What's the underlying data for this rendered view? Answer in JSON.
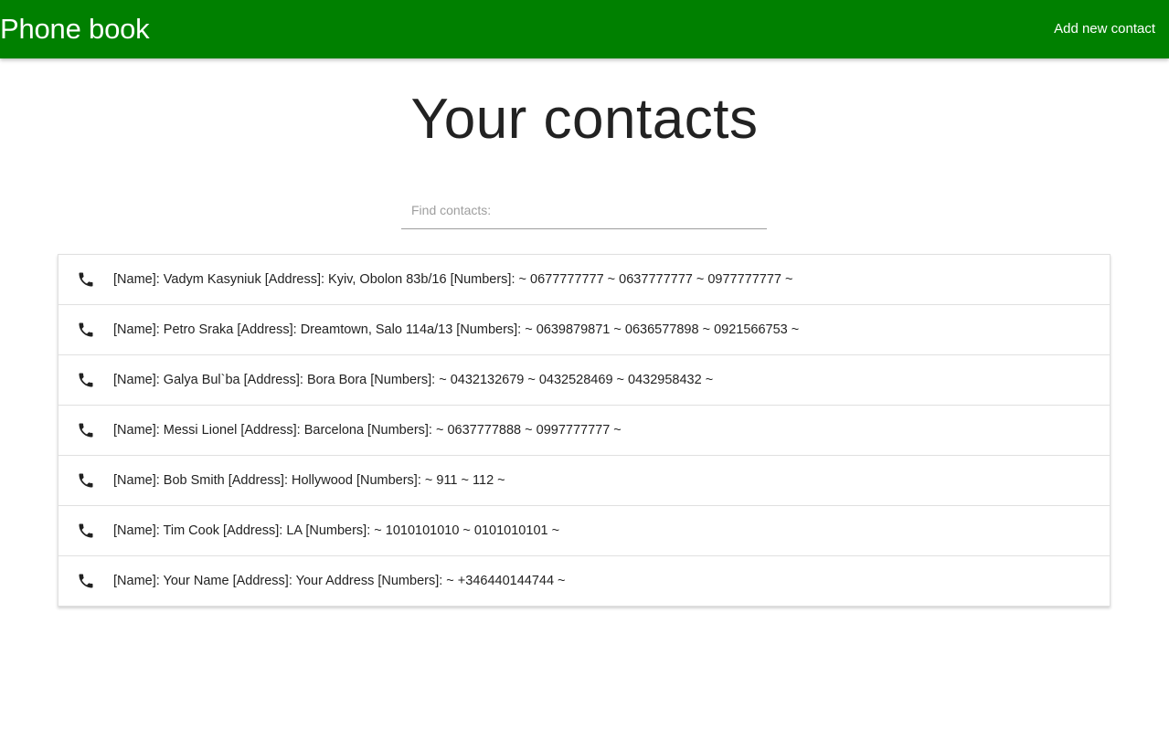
{
  "navbar": {
    "brand": "Phone book",
    "add_contact_label": "Add new contact",
    "background_color": "#008000"
  },
  "main": {
    "title": "Your contacts",
    "search": {
      "placeholder": "Find contacts:",
      "value": ""
    },
    "contacts": [
      {
        "icon": "phone-icon",
        "text": "[Name]: Vadym Kasyniuk [Address]: Kyiv, Obolon 83b/16 [Numbers]: ~ 0677777777 ~ 0637777777 ~ 0977777777 ~"
      },
      {
        "icon": "phone-icon",
        "text": "[Name]: Petro Sraka [Address]: Dreamtown, Salo 114a/13 [Numbers]: ~ 0639879871 ~ 0636577898 ~ 0921566753 ~"
      },
      {
        "icon": "phone-icon",
        "text": "[Name]: Galya Bul`ba [Address]: Bora Bora [Numbers]: ~ 0432132679 ~ 0432528469 ~ 0432958432 ~"
      },
      {
        "icon": "phone-icon",
        "text": "[Name]: Messi Lionel [Address]: Barcelona [Numbers]: ~ 0637777888 ~ 0997777777 ~"
      },
      {
        "icon": "phone-icon",
        "text": "[Name]: Bob Smith [Address]: Hollywood [Numbers]: ~ 911 ~ 112 ~"
      },
      {
        "icon": "phone-icon",
        "text": "[Name]: Tim Cook [Address]: LA [Numbers]: ~ 1010101010 ~ 0101010101 ~"
      },
      {
        "icon": "phone-icon",
        "text": "[Name]: Your Name [Address]: Your Address [Numbers]: ~ +346440144744 ~"
      }
    ]
  }
}
